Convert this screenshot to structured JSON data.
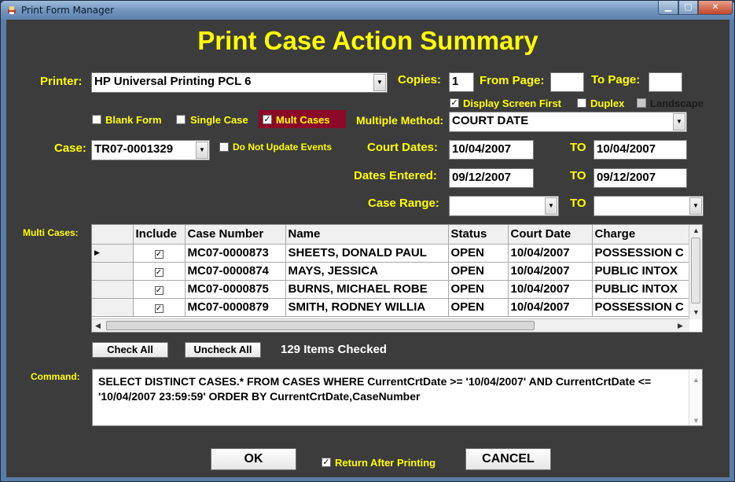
{
  "window": {
    "title": "Print Form Manager",
    "min_icon": "minimize-icon",
    "max_icon": "maximize-icon",
    "close_icon": "close-icon"
  },
  "heading": "Print Case Action Summary",
  "printer": {
    "label": "Printer:",
    "value": "HP Universal Printing PCL 6"
  },
  "copies": {
    "label": "Copies:",
    "value": "1"
  },
  "from_page": {
    "label": "From Page:",
    "value": ""
  },
  "to_page": {
    "label": "To Page:",
    "value": ""
  },
  "options": {
    "display_screen_first": {
      "label": "Display Screen First",
      "checked": true
    },
    "duplex": {
      "label": "Duplex",
      "checked": false
    },
    "landscape": {
      "label": "Landscape",
      "checked": false,
      "enabled": false
    },
    "blank_form": {
      "label": "Blank Form",
      "checked": false
    },
    "single_case": {
      "label": "Single Case",
      "checked": false
    },
    "mult_cases": {
      "label": "Mult Cases",
      "checked": true
    },
    "do_not_update_events": {
      "label": "Do Not Update Events",
      "checked": false
    }
  },
  "multiple_method": {
    "label": "Multiple Method:",
    "value": "COURT DATE"
  },
  "case": {
    "label": "Case:",
    "value": "TR07-0001329"
  },
  "court_dates": {
    "label": "Court Dates:",
    "from": "10/04/2007",
    "to_label": "TO",
    "to": "10/04/2007"
  },
  "dates_entered": {
    "label": "Dates Entered:",
    "from": "09/12/2007",
    "to_label": "TO",
    "to": "09/12/2007"
  },
  "case_range": {
    "label": "Case Range:",
    "from": "",
    "to_label": "TO",
    "to": ""
  },
  "multi_cases": {
    "label": "Multi Cases:",
    "columns": [
      "Include",
      "Case Number",
      "Name",
      "Status",
      "Court Date",
      "Charge"
    ],
    "rows": [
      {
        "include": true,
        "case_number": "MC07-0000873",
        "name": "SHEETS, DONALD PAUL",
        "status": "OPEN",
        "court_date": "10/04/2007",
        "charge": "POSSESSION C"
      },
      {
        "include": true,
        "case_number": "MC07-0000874",
        "name": "MAYS, JESSICA",
        "status": "OPEN",
        "court_date": "10/04/2007",
        "charge": "PUBLIC INTOX"
      },
      {
        "include": true,
        "case_number": "MC07-0000875",
        "name": "BURNS, MICHAEL ROBE",
        "status": "OPEN",
        "court_date": "10/04/2007",
        "charge": "PUBLIC INTOX"
      },
      {
        "include": true,
        "case_number": "MC07-0000879",
        "name": "SMITH, RODNEY WILLIA",
        "status": "OPEN",
        "court_date": "10/04/2007",
        "charge": "POSSESSION C"
      }
    ]
  },
  "check_all": "Check All",
  "uncheck_all": "Uncheck All",
  "items_checked": "129 Items Checked",
  "command": {
    "label": "Command:",
    "value": "SELECT DISTINCT CASES.* FROM CASES WHERE CurrentCrtDate >= '10/04/2007' AND CurrentCrtDate <= '10/04/2007 23:59:59'  ORDER BY CurrentCrtDate,CaseNumber"
  },
  "ok": "OK",
  "return_after_printing": {
    "label": "Return After Printing",
    "checked": true
  },
  "cancel": "CANCEL",
  "glyphs": {
    "check": "✓",
    "dropdown": "▼",
    "row_pointer": "▶",
    "up": "▲",
    "down": "▼",
    "left": "◀",
    "right": "▶"
  }
}
